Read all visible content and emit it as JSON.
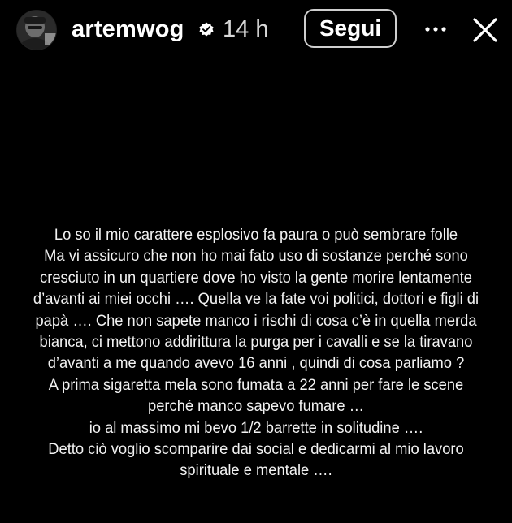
{
  "header": {
    "avatar_icon": "user-avatar",
    "username": "artemwog",
    "verified_icon": "verified-badge-icon",
    "timestamp": "14 h",
    "follow_label": "Segui",
    "more_icon": "more-options-icon",
    "close_icon": "close-icon"
  },
  "story": {
    "lines": [
      "Lo so il mio carattere esplosivo fa paura o può sembrare folle",
      "Ma vi assicuro che non ho mai fato uso di sostanze perché sono",
      "cresciuto in un quartiere dove ho visto la gente morire lentamente",
      "d’avanti ai miei occhi …. Quella ve la fate voi politici, dottori e figli di",
      "papà …. Che non sapete manco i rischi di cosa c’è in quella merda",
      "bianca, ci mettono addirittura la purga per i cavalli e se la tiravano",
      "d’avanti a me quando avevo 16 anni , quindi di cosa parliamo ?",
      "A prima sigaretta mela sono fumata a 22 anni per fare le scene",
      "perché manco sapevo fumare  …",
      "io al massimo mi bevo 1/2 barrette in solitudine ….",
      "Detto ciò voglio scomparire dai social e dedicarmi al mio lavoro",
      "spirituale e mentale …."
    ]
  },
  "colors": {
    "background": "#000000",
    "text": "#ffffff",
    "verified_badge": "#ffffff"
  }
}
